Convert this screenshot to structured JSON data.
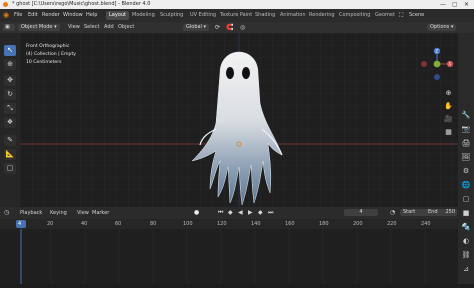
{
  "window": {
    "title": "* ghost [C:\\Users\\rego\\Music\\ghost.blend] - Blender 4.0",
    "controls": [
      "—",
      "▢",
      "✕"
    ]
  },
  "menu": {
    "items": [
      "File",
      "Edit",
      "Render",
      "Window",
      "Help"
    ],
    "workspaces": [
      "Layout",
      "Modeling",
      "Sculpting",
      "UV Editing",
      "Texture Paint",
      "Shading",
      "Animation",
      "Rendering",
      "Compositing",
      "Geomet"
    ],
    "active_workspace": "Layout",
    "scene_label": "Scene"
  },
  "viewport_header": {
    "mode": "Object Mode",
    "menus": [
      "View",
      "Select",
      "Add",
      "Object"
    ],
    "transform": "Global",
    "options": "Options"
  },
  "viewport": {
    "view_name": "Front Orthographic",
    "collection": "(4) Collection | Empty",
    "scale": "10 Centimeters",
    "gizmo_axis_z": "Z",
    "gizmo_axis_x": "X"
  },
  "timeline": {
    "menus": [
      "Playback",
      "Keying",
      "View",
      "Marker"
    ],
    "current_frame": "4",
    "start_label": "Start",
    "start": "1",
    "end_label": "End",
    "end": "250",
    "ruler": [
      "4",
      "20",
      "40",
      "60",
      "80",
      "100",
      "120",
      "140",
      "160",
      "180",
      "200",
      "220",
      "240"
    ]
  },
  "colors": {
    "active_blue": "#4772b3",
    "x_axis": "#b3403f",
    "y_axis": "#7fae3a",
    "z_axis": "#4b7ad6",
    "accent_orange": "#e87d0d"
  }
}
